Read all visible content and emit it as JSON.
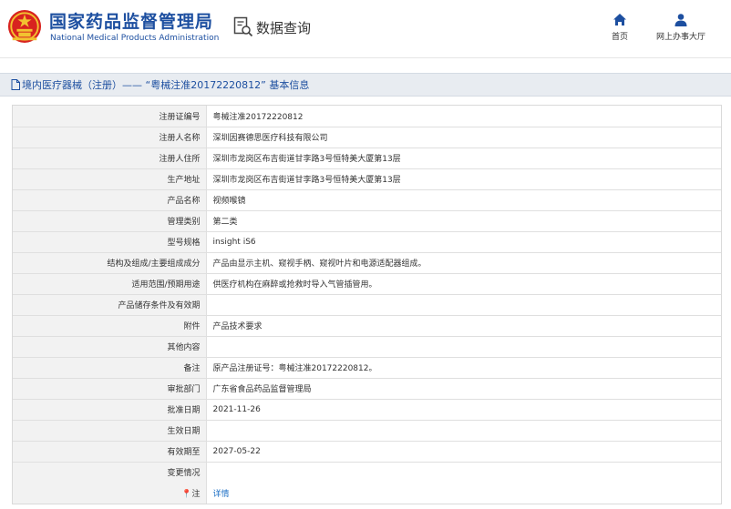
{
  "header": {
    "brand_cn": "国家药品监督管理局",
    "brand_en": "National Medical Products Administration",
    "query_label": "数据查询",
    "nav": {
      "home": "首页",
      "hall": "网上办事大厅"
    }
  },
  "titlebar": {
    "text": "境内医疗器械（注册）—— “粤械注准20172220812” 基本信息"
  },
  "rows": [
    {
      "label": "注册证编号",
      "value": "粤械注准20172220812"
    },
    {
      "label": "注册人名称",
      "value": "深圳因赛德思医疗科技有限公司"
    },
    {
      "label": "注册人住所",
      "value": "深圳市龙岗区布吉街道甘李路3号恒特美大厦第13层"
    },
    {
      "label": "生产地址",
      "value": "深圳市龙岗区布吉街道甘李路3号恒特美大厦第13层"
    },
    {
      "label": "产品名称",
      "value": "视频喉镜"
    },
    {
      "label": "管理类别",
      "value": "第二类"
    },
    {
      "label": "型号规格",
      "value": "insight iS6"
    },
    {
      "label": "结构及组成/主要组成成分",
      "value": "产品由显示主机、窥视手柄、窥视叶片和电源适配器组成。"
    },
    {
      "label": "适用范围/预期用途",
      "value": "供医疗机构在麻醉或抢救时导入气管插管用。"
    },
    {
      "label": "产品储存条件及有效期",
      "value": ""
    },
    {
      "label": "附件",
      "value": "产品技术要求"
    },
    {
      "label": "其他内容",
      "value": ""
    },
    {
      "label": "备注",
      "value": "原产品注册证号：粤械注准20172220812。"
    },
    {
      "label": "审批部门",
      "value": "广东省食品药品监督管理局"
    },
    {
      "label": "批准日期",
      "value": "2021-11-26"
    },
    {
      "label": "生效日期",
      "value": ""
    },
    {
      "label": "有效期至",
      "value": "2027-05-22"
    },
    {
      "label": "变更情况",
      "value": ""
    }
  ],
  "note_row": {
    "pin": "📍",
    "label": "注",
    "link": "详情"
  }
}
